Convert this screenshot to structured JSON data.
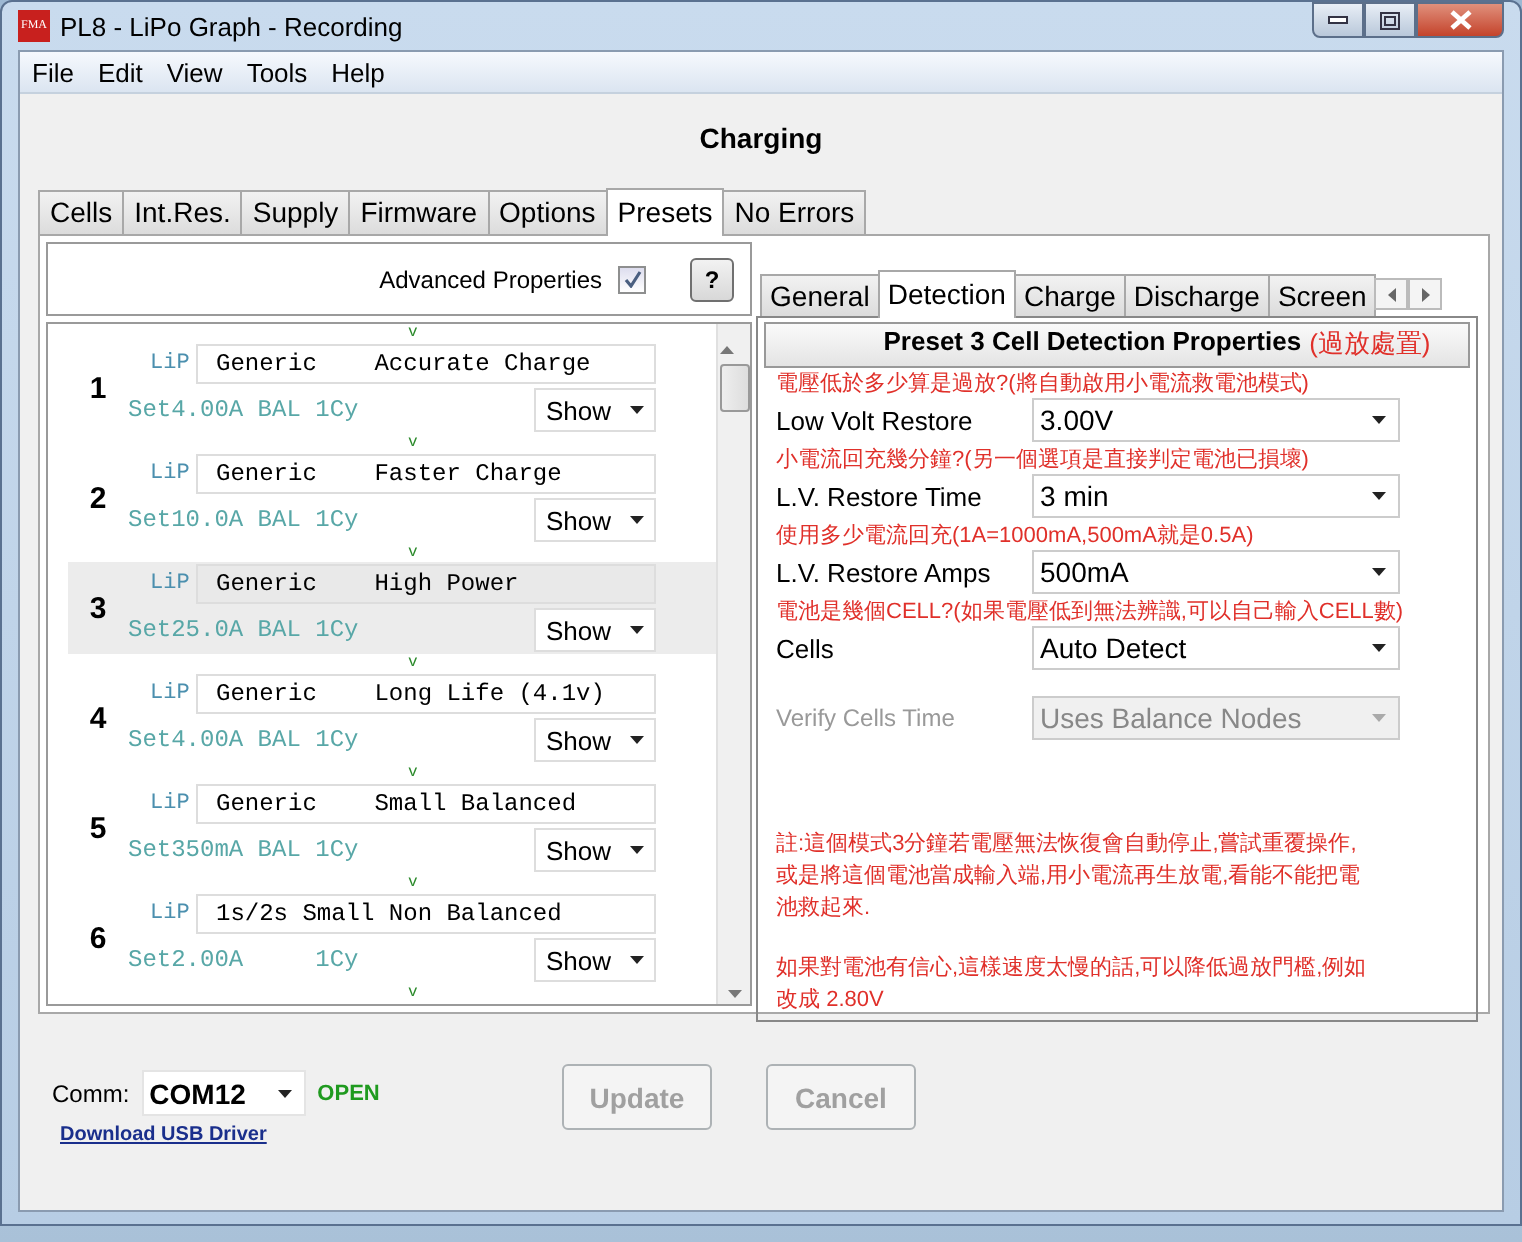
{
  "window": {
    "logo": "FMA",
    "title": "PL8 - LiPo Graph - Recording"
  },
  "menu": [
    "File",
    "Edit",
    "View",
    "Tools",
    "Help"
  ],
  "heading": "Charging",
  "tabs": [
    {
      "label": "Cells",
      "selected": false
    },
    {
      "label": "Int.Res.",
      "selected": false
    },
    {
      "label": "Supply",
      "selected": false
    },
    {
      "label": "Firmware",
      "selected": false
    },
    {
      "label": "Options",
      "selected": false
    },
    {
      "label": "Presets",
      "selected": true
    },
    {
      "label": "No Errors",
      "selected": false
    }
  ],
  "presets_panel": {
    "advanced_label": "Advanced Properties",
    "advanced_checked": true,
    "help_button": "?",
    "presets": [
      {
        "number": "1",
        "marker": "v",
        "type": "LiP",
        "name": "Generic    Accurate Charge",
        "settings": "Set4.00A BAL 1Cy",
        "view": "Show",
        "selected": false
      },
      {
        "number": "2",
        "marker": "v",
        "type": "LiP",
        "name": "Generic    Faster Charge",
        "settings": "Set10.0A BAL 1Cy",
        "view": "Show",
        "selected": false
      },
      {
        "number": "3",
        "marker": "v",
        "type": "LiP",
        "name": "Generic    High Power",
        "settings": "Set25.0A BAL 1Cy",
        "view": "Show",
        "selected": true
      },
      {
        "number": "4",
        "marker": "v",
        "type": "LiP",
        "name": "Generic    Long Life (4.1v)",
        "settings": "Set4.00A BAL 1Cy",
        "view": "Show",
        "selected": false
      },
      {
        "number": "5",
        "marker": "v",
        "type": "LiP",
        "name": "Generic    Small Balanced",
        "settings": "Set350mA BAL 1Cy",
        "view": "Show",
        "selected": false
      },
      {
        "number": "6",
        "marker": "v",
        "type": "LiP",
        "name": "1s/2s Small Non Balanced",
        "settings": "Set2.00A     1Cy",
        "view": "Show",
        "selected": false
      }
    ],
    "end_marker": "v"
  },
  "detail_panel": {
    "tabs": [
      {
        "label": "General",
        "selected": false
      },
      {
        "label": "Detection",
        "selected": true
      },
      {
        "label": "Charge",
        "selected": false
      },
      {
        "label": "Discharge",
        "selected": false
      },
      {
        "label": "Screen",
        "selected": false
      }
    ],
    "title": "Preset 3  Cell Detection Properties",
    "title_note": "(過放處置)",
    "fields": [
      {
        "note": "電壓低於多少算是過放?(將自動啟用小電流救電池模式)",
        "label": "Low Volt Restore",
        "value": "3.00V",
        "disabled": false
      },
      {
        "note": "小電流回充幾分鐘?(另一個選項是直接判定電池已損壞)",
        "label": "L.V. Restore Time",
        "value": "3 min",
        "disabled": false
      },
      {
        "note": "使用多少電流回充(1A=1000mA,500mA就是0.5A)",
        "label": "L.V. Restore Amps",
        "value": "500mA",
        "disabled": false
      },
      {
        "note": "電池是幾個CELL?(如果電壓低到無法辨識,可以自己輸入CELL數)",
        "label": "Cells",
        "value": "Auto Detect",
        "disabled": false
      },
      {
        "label": "Verify Cells Time",
        "value": "Uses Balance Nodes",
        "disabled": true
      }
    ],
    "notes": [
      "註:這個模式3分鐘若電壓無法恢復會自動停止,嘗試重覆操作,或是將這個電池當成輸入端,用小電流再生放電,看能不能把電池救起來.",
      "如果對電池有信心,這樣速度太慢的話,可以降低過放門檻,例如改成 2.80V"
    ]
  },
  "footer": {
    "comm_label": "Comm:",
    "port": "COM12",
    "status": "OPEN",
    "driver_link": "Download USB Driver",
    "buttons": [
      {
        "label": "Update",
        "disabled": true
      },
      {
        "label": "Cancel",
        "disabled": true
      }
    ]
  }
}
